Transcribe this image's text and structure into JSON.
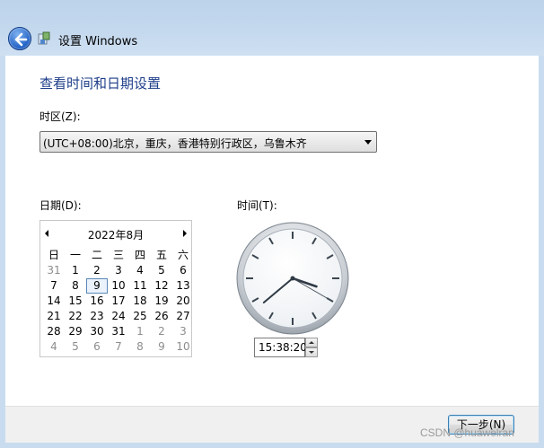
{
  "window": {
    "title": "设置 Windows"
  },
  "page": {
    "heading": "查看时间和日期设置"
  },
  "timezone": {
    "label": "时区(Z):",
    "selected": "(UTC+08:00)北京，重庆，香港特别行政区，乌鲁木齐"
  },
  "date": {
    "label": "日期(D):",
    "month_title": "2022年8月",
    "weekdays": [
      "日",
      "一",
      "二",
      "三",
      "四",
      "五",
      "六"
    ],
    "weeks": [
      [
        "31",
        "1",
        "2",
        "3",
        "4",
        "5",
        "6"
      ],
      [
        "7",
        "8",
        "9",
        "10",
        "11",
        "12",
        "13"
      ],
      [
        "14",
        "15",
        "16",
        "17",
        "18",
        "19",
        "20"
      ],
      [
        "21",
        "22",
        "23",
        "24",
        "25",
        "26",
        "27"
      ],
      [
        "28",
        "29",
        "30",
        "31",
        "1",
        "2",
        "3"
      ],
      [
        "4",
        "5",
        "6",
        "7",
        "8",
        "9",
        "10"
      ]
    ],
    "selected_day": "9"
  },
  "time": {
    "label": "时间(T):",
    "value": "15:38:20"
  },
  "buttons": {
    "next": "下一步(N)"
  },
  "watermark": "CSDN @huawelran"
}
